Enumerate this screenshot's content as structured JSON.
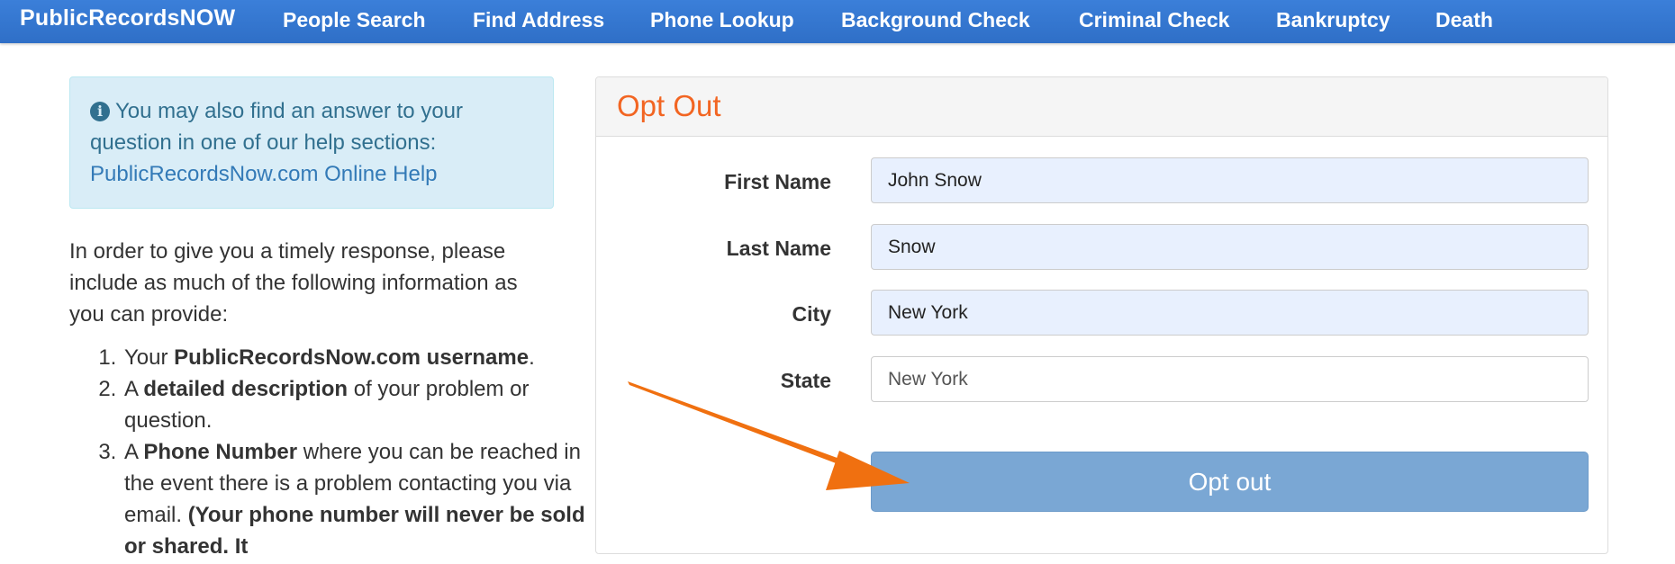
{
  "nav": {
    "brand": "PublicRecordsNOW",
    "items": [
      "People Search",
      "Find Address",
      "Phone Lookup",
      "Background Check",
      "Criminal Check",
      "Bankruptcy",
      "Death"
    ]
  },
  "help_box": {
    "text": "You may also find an answer to your question in one of our help sections:",
    "link": "PublicRecordsNow.com Online Help"
  },
  "intro": "In order to give you a timely response, please include as much of the following information as you can provide:",
  "steps": [
    {
      "pre": "Your ",
      "bold": "PublicRecordsNow.com username",
      "post": "."
    },
    {
      "pre": "A ",
      "bold": "detailed description",
      "post": " of your problem or question."
    },
    {
      "pre": "A ",
      "bold": "Phone Number",
      "post": " where you can be reached in the event there is a problem contacting you via email. ",
      "bold2": "(Your phone number will never be sold or shared. It"
    }
  ],
  "form": {
    "title": "Opt Out",
    "first_name_label": "First Name",
    "first_name_value": "John Snow",
    "last_name_label": "Last Name",
    "last_name_value": "Snow",
    "city_label": "City",
    "city_value": "New York",
    "state_label": "State",
    "state_placeholder": "New York",
    "submit_label": "Opt out"
  },
  "colors": {
    "navbar": "#3a7bd5",
    "title": "#f26522",
    "annotation_arrow": "#f07010",
    "button": "#7aa7d4"
  },
  "icons": [
    "info-circle-icon",
    "annotation-arrow-icon"
  ]
}
